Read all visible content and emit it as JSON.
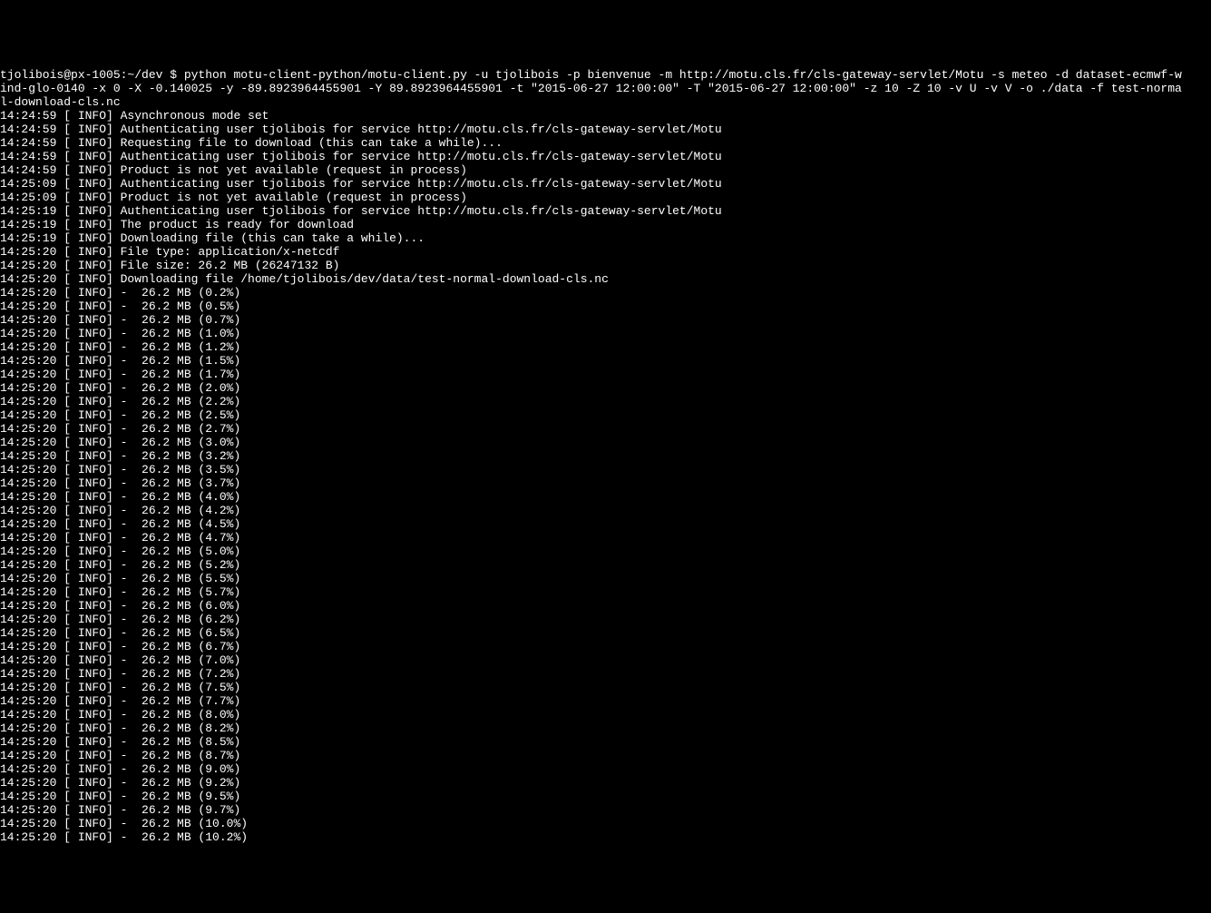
{
  "terminal": {
    "prompt_line": "tjolibois@px-1005:~/dev $ python motu-client-python/motu-client.py -u tjolibois -p bienvenue -m http://motu.cls.fr/cls-gateway-servlet/Motu -s meteo -d dataset-ecmwf-w",
    "prompt_line_2": "ind-glo-0140 -x 0 -X -0.140025 -y -89.8923964455901 -Y 89.8923964455901 -t \"2015-06-27 12:00:00\" -T \"2015-06-27 12:00:00\" -z 10 -Z 10 -v U -v V -o ./data -f test-norma",
    "prompt_line_3": "l-download-cls.nc",
    "info_lines": [
      "14:24:59 [ INFO] Asynchronous mode set",
      "14:24:59 [ INFO] Authenticating user tjolibois for service http://motu.cls.fr/cls-gateway-servlet/Motu",
      "14:24:59 [ INFO] Requesting file to download (this can take a while)...",
      "14:24:59 [ INFO] Authenticating user tjolibois for service http://motu.cls.fr/cls-gateway-servlet/Motu",
      "14:24:59 [ INFO] Product is not yet available (request in process)",
      "14:25:09 [ INFO] Authenticating user tjolibois for service http://motu.cls.fr/cls-gateway-servlet/Motu",
      "14:25:09 [ INFO] Product is not yet available (request in process)",
      "14:25:19 [ INFO] Authenticating user tjolibois for service http://motu.cls.fr/cls-gateway-servlet/Motu",
      "14:25:19 [ INFO] The product is ready for download",
      "14:25:19 [ INFO] Downloading file (this can take a while)...",
      "14:25:20 [ INFO] File type: application/x-netcdf",
      "14:25:20 [ INFO] File size: 26.2 MB (26247132 B)",
      "14:25:20 [ INFO] Downloading file /home/tjolibois/dev/data/test-normal-download-cls.nc"
    ],
    "progress_lines": [
      "14:25:20 [ INFO] -  26.2 MB (0.2%)",
      "14:25:20 [ INFO] -  26.2 MB (0.5%)",
      "14:25:20 [ INFO] -  26.2 MB (0.7%)",
      "14:25:20 [ INFO] -  26.2 MB (1.0%)",
      "14:25:20 [ INFO] -  26.2 MB (1.2%)",
      "14:25:20 [ INFO] -  26.2 MB (1.5%)",
      "14:25:20 [ INFO] -  26.2 MB (1.7%)",
      "14:25:20 [ INFO] -  26.2 MB (2.0%)",
      "14:25:20 [ INFO] -  26.2 MB (2.2%)",
      "14:25:20 [ INFO] -  26.2 MB (2.5%)",
      "14:25:20 [ INFO] -  26.2 MB (2.7%)",
      "14:25:20 [ INFO] -  26.2 MB (3.0%)",
      "14:25:20 [ INFO] -  26.2 MB (3.2%)",
      "14:25:20 [ INFO] -  26.2 MB (3.5%)",
      "14:25:20 [ INFO] -  26.2 MB (3.7%)",
      "14:25:20 [ INFO] -  26.2 MB (4.0%)",
      "14:25:20 [ INFO] -  26.2 MB (4.2%)",
      "14:25:20 [ INFO] -  26.2 MB (4.5%)",
      "14:25:20 [ INFO] -  26.2 MB (4.7%)",
      "14:25:20 [ INFO] -  26.2 MB (5.0%)",
      "14:25:20 [ INFO] -  26.2 MB (5.2%)",
      "14:25:20 [ INFO] -  26.2 MB (5.5%)",
      "14:25:20 [ INFO] -  26.2 MB (5.7%)",
      "14:25:20 [ INFO] -  26.2 MB (6.0%)",
      "14:25:20 [ INFO] -  26.2 MB (6.2%)",
      "14:25:20 [ INFO] -  26.2 MB (6.5%)",
      "14:25:20 [ INFO] -  26.2 MB (6.7%)",
      "14:25:20 [ INFO] -  26.2 MB (7.0%)",
      "14:25:20 [ INFO] -  26.2 MB (7.2%)",
      "14:25:20 [ INFO] -  26.2 MB (7.5%)",
      "14:25:20 [ INFO] -  26.2 MB (7.7%)",
      "14:25:20 [ INFO] -  26.2 MB (8.0%)",
      "14:25:20 [ INFO] -  26.2 MB (8.2%)",
      "14:25:20 [ INFO] -  26.2 MB (8.5%)",
      "14:25:20 [ INFO] -  26.2 MB (8.7%)",
      "14:25:20 [ INFO] -  26.2 MB (9.0%)",
      "14:25:20 [ INFO] -  26.2 MB (9.2%)",
      "14:25:20 [ INFO] -  26.2 MB (9.5%)",
      "14:25:20 [ INFO] -  26.2 MB (9.7%)",
      "14:25:20 [ INFO] -  26.2 MB (10.0%)",
      "14:25:20 [ INFO] -  26.2 MB (10.2%)"
    ]
  }
}
